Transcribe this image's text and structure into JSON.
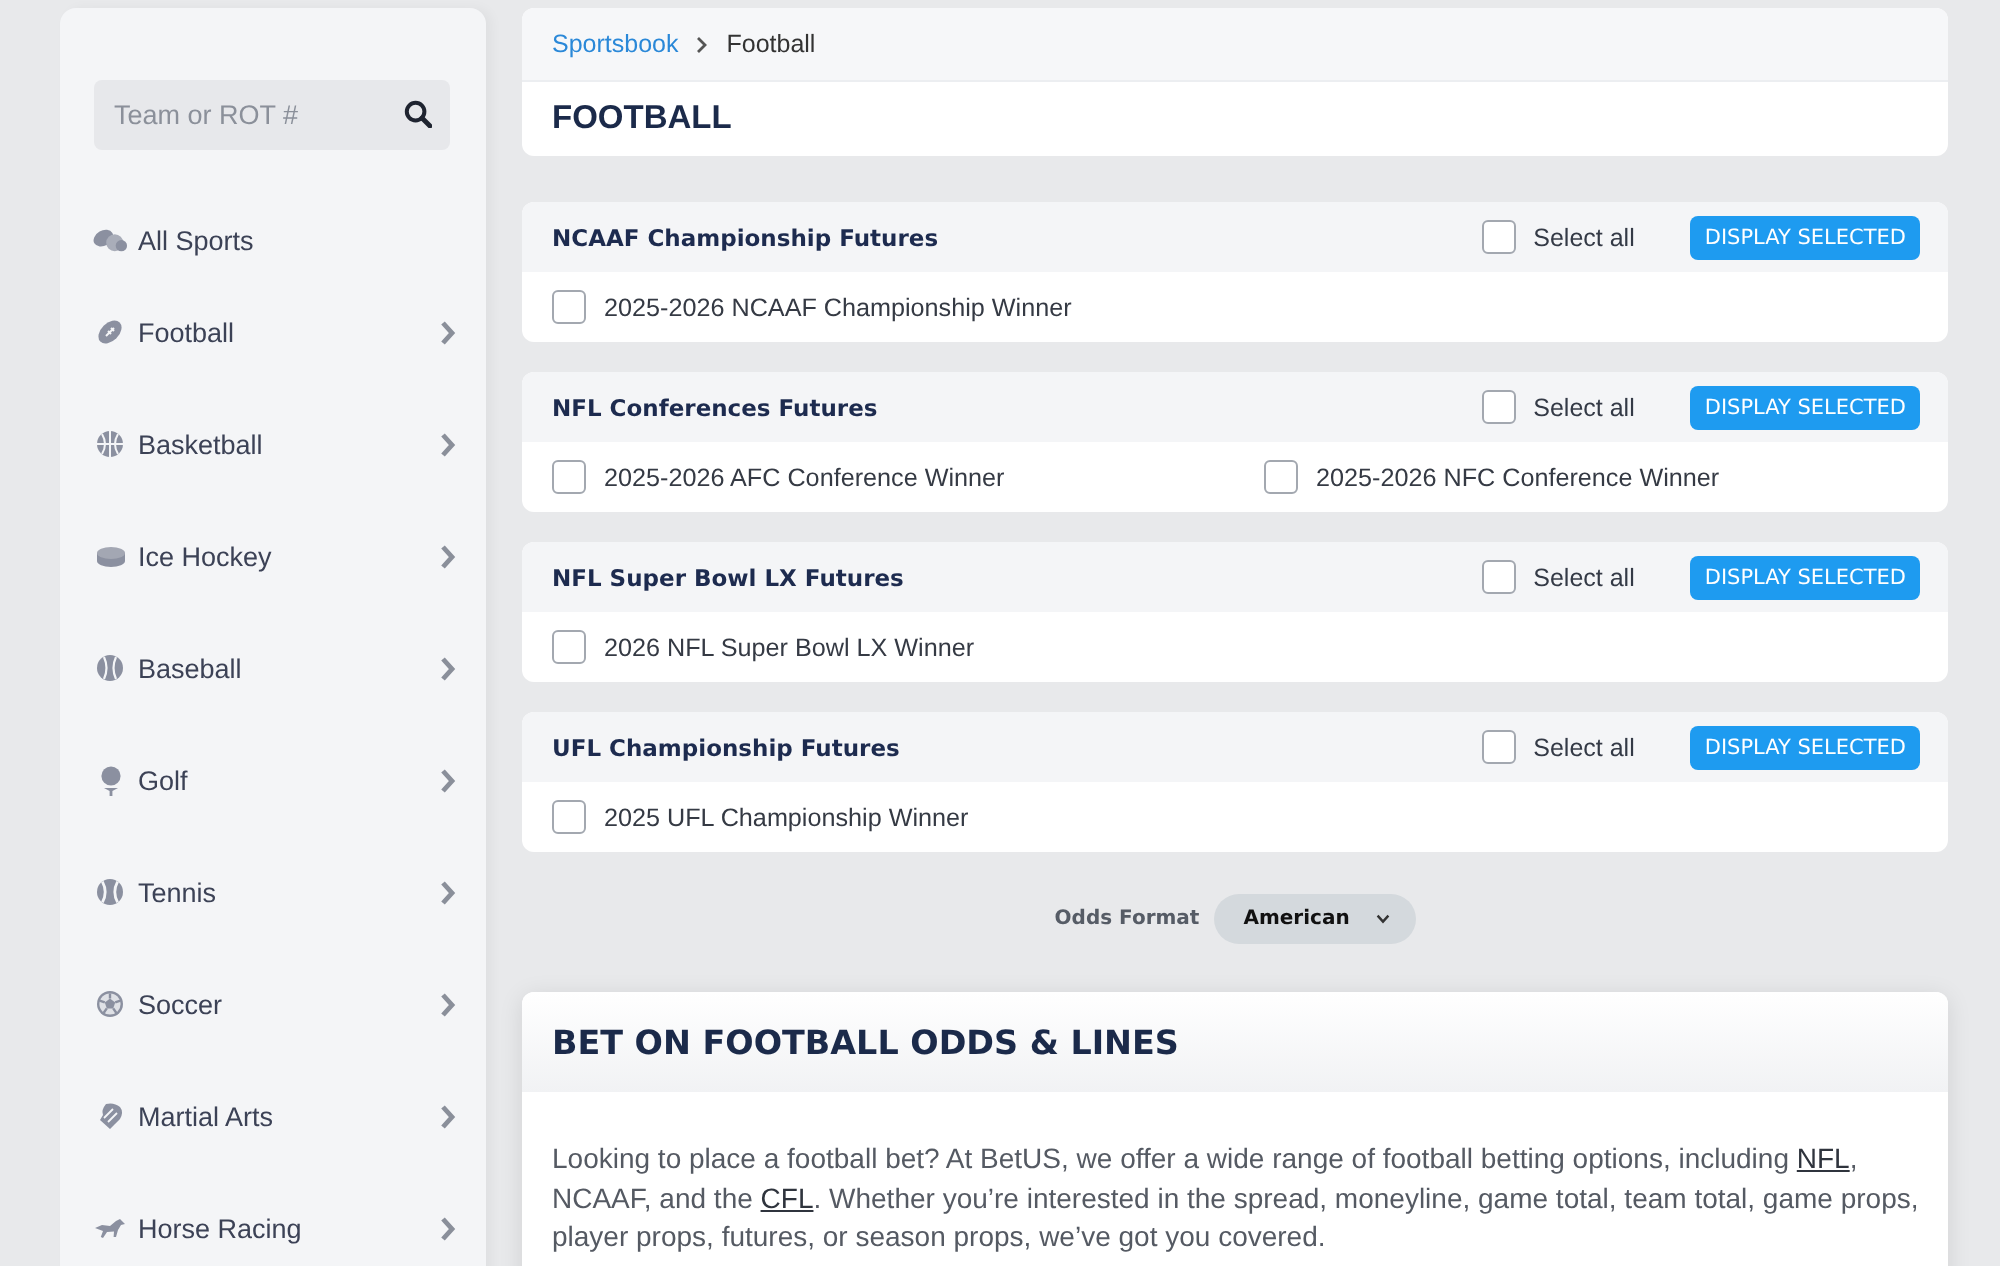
{
  "sidebar": {
    "search": {
      "placeholder": "Team or ROT #"
    },
    "items": [
      {
        "label": "All Sports",
        "expandable": false
      },
      {
        "label": "Football",
        "expandable": true
      },
      {
        "label": "Basketball",
        "expandable": true
      },
      {
        "label": "Ice Hockey",
        "expandable": true
      },
      {
        "label": "Baseball",
        "expandable": true
      },
      {
        "label": "Golf",
        "expandable": true
      },
      {
        "label": "Tennis",
        "expandable": true
      },
      {
        "label": "Soccer",
        "expandable": true
      },
      {
        "label": "Martial Arts",
        "expandable": true
      },
      {
        "label": "Horse Racing",
        "expandable": true
      }
    ]
  },
  "breadcrumb": [
    {
      "label": "Sportsbook",
      "kind": "link"
    },
    {
      "label": "Football",
      "kind": "current"
    }
  ],
  "page_title": "FOOTBALL",
  "sections": [
    {
      "title": "NCAAF Championship Futures",
      "select_all": {
        "label": "Select all",
        "checked": false
      },
      "button": "DISPLAY SELECTED",
      "markets": [
        {
          "label": "2025-2026 NCAAF Championship Winner",
          "checked": false
        }
      ]
    },
    {
      "title": "NFL Conferences Futures",
      "select_all": {
        "label": "Select all",
        "checked": false
      },
      "button": "DISPLAY SELECTED",
      "markets": [
        {
          "label": "2025-2026 AFC Conference Winner",
          "checked": false
        },
        {
          "label": "2025-2026 NFC Conference Winner",
          "checked": false
        }
      ]
    },
    {
      "title": "NFL Super Bowl LX Futures",
      "select_all": {
        "label": "Select all",
        "checked": false
      },
      "button": "DISPLAY SELECTED",
      "markets": [
        {
          "label": "2026 NFL Super Bowl LX Winner",
          "checked": false
        }
      ]
    },
    {
      "title": "UFL Championship Futures",
      "select_all": {
        "label": "Select all",
        "checked": false
      },
      "button": "DISPLAY SELECTED",
      "markets": [
        {
          "label": "2025 UFL Championship Winner",
          "checked": false
        }
      ]
    }
  ],
  "odds_format": {
    "label": "Odds Format",
    "value": "American"
  },
  "article": {
    "title": "BET ON FOOTBALL ODDS & LINES",
    "paragraph": [
      {
        "kind": "text",
        "text": "Looking to place a football bet? At BetUS, we offer a wide range of football betting options, including "
      },
      {
        "kind": "link",
        "text": "NFL"
      },
      {
        "kind": "text",
        "text": ", NCAAF, and the "
      },
      {
        "kind": "link",
        "text": "CFL"
      },
      {
        "kind": "text",
        "text": ". Whether you’re interested in the spread, moneyline, game total, team total, game props, player props, futures, or season props, we’ve got you covered."
      }
    ]
  }
}
